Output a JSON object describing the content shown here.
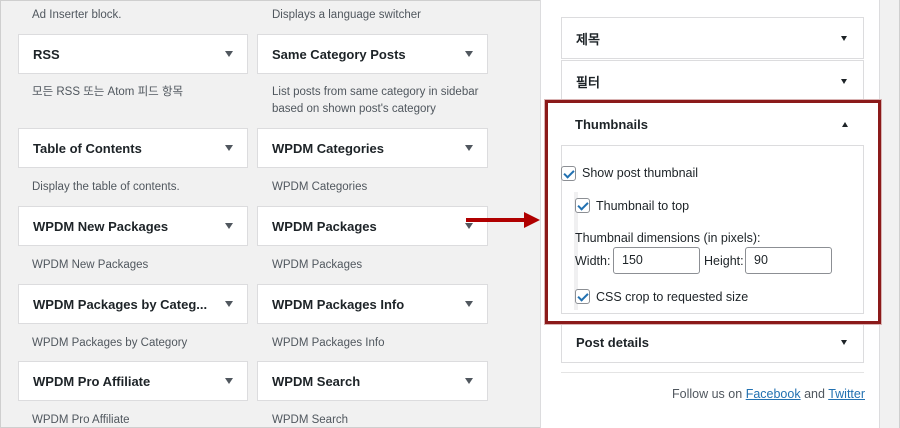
{
  "widgets": {
    "descriptions": {
      "ad_inserter": "Ad Inserter block.",
      "lang_switcher": "Displays a language switcher",
      "rss": "모든 RSS 또는 Atom 피드 항목",
      "same_cat_line1": "List posts from same category in sidebar",
      "same_cat_line2": "based on shown post's category",
      "toc": "Display the table of contents.",
      "wpdm_categories": "WPDM Categories",
      "wpdm_new_packages": "WPDM New Packages",
      "wpdm_packages": "WPDM Packages",
      "wpdm_packages_by_category": "WPDM Packages by Category",
      "wpdm_packages_info": "WPDM Packages Info",
      "wpdm_pro_affiliate": "WPDM Pro Affiliate",
      "wpdm_search": "WPDM Search"
    },
    "items": [
      {
        "label": "RSS"
      },
      {
        "label": "Same Category Posts"
      },
      {
        "label": "Table of Contents"
      },
      {
        "label": "WPDM Categories"
      },
      {
        "label": "WPDM New Packages"
      },
      {
        "label": "WPDM Packages"
      },
      {
        "label": "WPDM Packages by Categ..."
      },
      {
        "label": "WPDM Packages Info"
      },
      {
        "label": "WPDM Pro Affiliate"
      },
      {
        "label": "WPDM Search"
      }
    ]
  },
  "panel": {
    "sections": {
      "title": "제목",
      "filter": "필터",
      "thumbnails": "Thumbnails",
      "post_details": "Post details"
    },
    "thumbnails": {
      "show_post_thumbnail": "Show post thumbnail",
      "show_post_thumbnail_checked": true,
      "thumbnail_to_top": "Thumbnail to top",
      "thumbnail_to_top_checked": true,
      "dimensions_label": "Thumbnail dimensions (in pixels):",
      "width_label": "Width:",
      "width_value": "150",
      "height_label": "Height:",
      "height_value": "90",
      "css_crop": "CSS crop to requested size",
      "css_crop_checked": true
    },
    "footer": {
      "prefix": "Follow us on",
      "facebook": "Facebook",
      "and": "and",
      "twitter": "Twitter"
    }
  },
  "colors": {
    "highlight_border": "#8b1a1a",
    "arrow": "#b00000",
    "link": "#2271b1",
    "checkbox_tick": "#2271b1"
  }
}
